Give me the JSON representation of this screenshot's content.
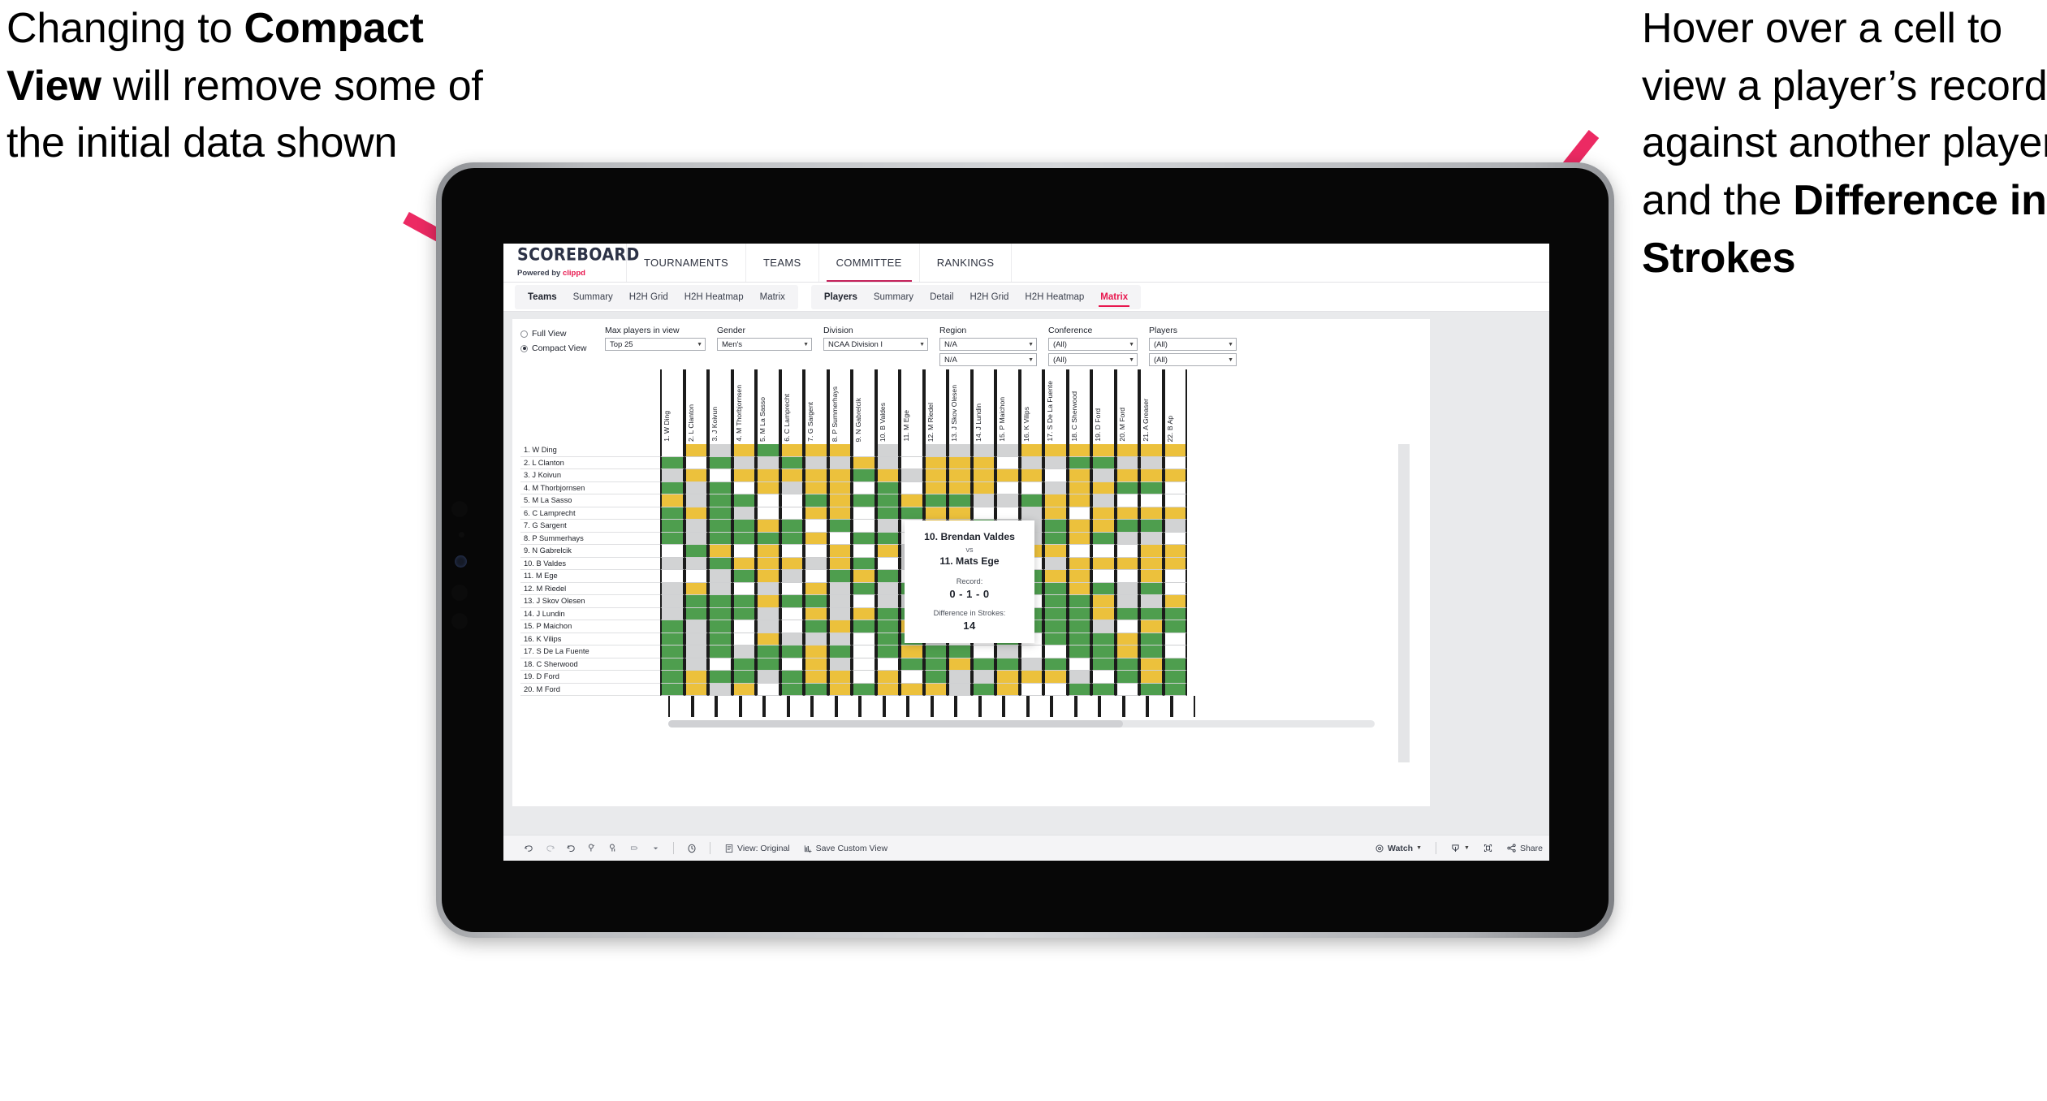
{
  "annotations": {
    "left": {
      "pre": "Changing to ",
      "bold": "Compact View",
      "post": " will remove some of the initial data shown"
    },
    "right": {
      "pre": "Hover over a cell to view a player’s record against another player and the ",
      "bold": "Difference in Strokes"
    },
    "arrow_color": "#ec2a63"
  },
  "app": {
    "brand": {
      "title": "SCOREBOARD",
      "sub_prefix": "Powered by ",
      "sub_brand": "clippd"
    },
    "top_nav": [
      {
        "label": "TOURNAMENTS",
        "active": false
      },
      {
        "label": "TEAMS",
        "active": false
      },
      {
        "label": "COMMITTEE",
        "active": true
      },
      {
        "label": "RANKINGS",
        "active": false
      }
    ],
    "sub_nav": {
      "teams_group": {
        "title": "Teams",
        "items": [
          "Summary",
          "H2H Grid",
          "H2H Heatmap",
          "Matrix"
        ],
        "active": null
      },
      "players_group": {
        "title": "Players",
        "items": [
          "Summary",
          "Detail",
          "H2H Grid",
          "H2H Heatmap",
          "Matrix"
        ],
        "active": "Matrix"
      }
    }
  },
  "filters": {
    "view_mode": {
      "options": [
        "Full View",
        "Compact View"
      ],
      "selected": "Compact View"
    },
    "dropdowns": [
      {
        "label": "Max players in view",
        "value": "Top 25",
        "second": null
      },
      {
        "label": "Gender",
        "value": "Men's",
        "second": null
      },
      {
        "label": "Division",
        "value": "NCAA Division I",
        "second": null
      },
      {
        "label": "Region",
        "value": "N/A",
        "second": "N/A"
      },
      {
        "label": "Conference",
        "value": "(All)",
        "second": "(All)"
      },
      {
        "label": "Players",
        "value": "(All)",
        "second": "(All)"
      }
    ]
  },
  "matrix": {
    "columns": [
      "1. W Ding",
      "2. L Clanton",
      "3. J Koivun",
      "4. M Thorbjornsen",
      "5. M La Sasso",
      "6. C Lamprecht",
      "7. G Sargent",
      "8. P Summerhays",
      "9. N Gabrelcik",
      "10. B Valdes",
      "11. M Ege",
      "12. M Riedel",
      "13. J Skov Olesen",
      "14. J Lundin",
      "15. P Maichon",
      "16. K Vilips",
      "17. S De La Fuente",
      "18. C Sherwood",
      "19. D Ford",
      "20. M Ford",
      "21. A Greaser",
      "22. B Ap"
    ],
    "rows": [
      "1. W Ding",
      "2. L Clanton",
      "3. J Koivun",
      "4. M Thorbjornsen",
      "5. M La Sasso",
      "6. C Lamprecht",
      "7. G Sargent",
      "8. P Summerhays",
      "9. N Gabrelcik",
      "10. B Valdes",
      "11. M Ege",
      "12. M Riedel",
      "13. J Skov Olesen",
      "14. J Lundin",
      "15. P Maichon",
      "16. K Vilips",
      "17. S De La Fuente",
      "18. C Sherwood",
      "19. D Ford",
      "20. M Ford"
    ],
    "legend": {
      "win": "#4e9e4e",
      "tie": "#ecc13c",
      "loss": "#d2d3d4",
      "none": "#ffffff"
    },
    "cells": [
      [
        "w",
        "y",
        "s",
        "y",
        "g",
        "y",
        "y",
        "y",
        "w",
        "s",
        "w",
        "s",
        "s",
        "s",
        "s",
        "y",
        "y",
        "y",
        "y",
        "y",
        "y",
        "y"
      ],
      [
        "g",
        "w",
        "g",
        "s",
        "s",
        "g",
        "s",
        "s",
        "y",
        "s",
        "w",
        "y",
        "y",
        "y",
        "w",
        "s",
        "s",
        "g",
        "g",
        "s",
        "s",
        "w"
      ],
      [
        "s",
        "y",
        "w",
        "y",
        "y",
        "y",
        "y",
        "y",
        "g",
        "y",
        "s",
        "y",
        "y",
        "y",
        "y",
        "y",
        "w",
        "y",
        "s",
        "y",
        "y",
        "y"
      ],
      [
        "g",
        "s",
        "g",
        "w",
        "y",
        "s",
        "y",
        "y",
        "w",
        "g",
        "w",
        "y",
        "y",
        "y",
        "w",
        "w",
        "s",
        "y",
        "y",
        "g",
        "g",
        "w"
      ],
      [
        "y",
        "s",
        "g",
        "g",
        "w",
        "w",
        "g",
        "y",
        "g",
        "g",
        "y",
        "g",
        "g",
        "s",
        "s",
        "g",
        "y",
        "y",
        "s",
        "w",
        "w",
        "w"
      ],
      [
        "g",
        "y",
        "g",
        "s",
        "w",
        "w",
        "y",
        "y",
        "w",
        "g",
        "g",
        "y",
        "y",
        "w",
        "w",
        "s",
        "y",
        "w",
        "y",
        "y",
        "y",
        "y"
      ],
      [
        "g",
        "s",
        "g",
        "g",
        "y",
        "g",
        "w",
        "g",
        "w",
        "s",
        "w",
        "y",
        "y",
        "g",
        "s",
        "s",
        "g",
        "y",
        "y",
        "g",
        "g",
        "s"
      ],
      [
        "g",
        "s",
        "g",
        "g",
        "g",
        "g",
        "y",
        "w",
        "g",
        "g",
        "w",
        "s",
        "y",
        "s",
        "g",
        "s",
        "g",
        "y",
        "g",
        "s",
        "s",
        "w"
      ],
      [
        "w",
        "g",
        "y",
        "w",
        "y",
        "w",
        "w",
        "y",
        "w",
        "y",
        "s",
        "g",
        "s",
        "s",
        "g",
        "y",
        "y",
        "w",
        "w",
        "w",
        "y",
        "y"
      ],
      [
        "s",
        "s",
        "g",
        "y",
        "y",
        "y",
        "s",
        "y",
        "g",
        "w",
        "s",
        "g",
        "s",
        "y",
        "y",
        "w",
        "s",
        "y",
        "y",
        "y",
        "y",
        "y"
      ],
      [
        "w",
        "w",
        "s",
        "g",
        "y",
        "s",
        "w",
        "g",
        "y",
        "g",
        "w",
        "s",
        "s",
        "g",
        "y",
        "g",
        "y",
        "y",
        "w",
        "w",
        "y",
        "w"
      ],
      [
        "s",
        "y",
        "s",
        "w",
        "s",
        "w",
        "y",
        "s",
        "g",
        "s",
        "g",
        "w",
        "g",
        "s",
        "w",
        "g",
        "g",
        "y",
        "g",
        "s",
        "g",
        "w"
      ],
      [
        "s",
        "g",
        "g",
        "g",
        "y",
        "g",
        "g",
        "s",
        "w",
        "s",
        "s",
        "s",
        "w",
        "g",
        "s",
        "w",
        "g",
        "g",
        "y",
        "s",
        "s",
        "y"
      ],
      [
        "s",
        "g",
        "g",
        "g",
        "s",
        "w",
        "y",
        "s",
        "y",
        "g",
        "g",
        "w",
        "s",
        "w",
        "y",
        "g",
        "g",
        "g",
        "y",
        "g",
        "g",
        "g"
      ],
      [
        "g",
        "s",
        "g",
        "w",
        "s",
        "w",
        "g",
        "y",
        "g",
        "g",
        "y",
        "g",
        "w",
        "y",
        "w",
        "g",
        "g",
        "g",
        "s",
        "w",
        "y",
        "g"
      ],
      [
        "g",
        "s",
        "g",
        "w",
        "y",
        "s",
        "s",
        "s",
        "w",
        "g",
        "g",
        "s",
        "w",
        "w",
        "g",
        "w",
        "g",
        "g",
        "g",
        "y",
        "g",
        "w"
      ],
      [
        "g",
        "s",
        "g",
        "s",
        "g",
        "g",
        "y",
        "g",
        "w",
        "g",
        "y",
        "g",
        "g",
        "w",
        "s",
        "w",
        "w",
        "g",
        "g",
        "y",
        "g",
        "w"
      ],
      [
        "g",
        "s",
        "w",
        "g",
        "g",
        "w",
        "y",
        "s",
        "w",
        "w",
        "g",
        "g",
        "y",
        "g",
        "g",
        "s",
        "g",
        "w",
        "g",
        "g",
        "y",
        "g"
      ],
      [
        "g",
        "y",
        "g",
        "g",
        "s",
        "g",
        "y",
        "y",
        "w",
        "y",
        "w",
        "g",
        "s",
        "s",
        "y",
        "y",
        "y",
        "s",
        "w",
        "g",
        "y",
        "g"
      ],
      [
        "g",
        "y",
        "s",
        "y",
        "w",
        "g",
        "g",
        "y",
        "g",
        "y",
        "y",
        "y",
        "s",
        "g",
        "y",
        "w",
        "w",
        "g",
        "g",
        "w",
        "g",
        "g"
      ]
    ]
  },
  "tooltip": {
    "player_a": "10. Brendan Valdes",
    "vs": "vs",
    "player_b": "11. Mats Ege",
    "record_label": "Record:",
    "record_value": "0 - 1 - 0",
    "strokes_label": "Difference in Strokes:",
    "strokes_value": "14"
  },
  "toolbar": {
    "icons": [
      "undo-icon",
      "redo-icon",
      "revert-icon",
      "refresh-icon",
      "pause-icon",
      "highlight-icon",
      "caret-icon",
      "clock-icon"
    ],
    "items": [
      {
        "icon": "view-icon",
        "label": "View: Original"
      },
      {
        "icon": "save-view-icon",
        "label": "Save Custom View"
      },
      {
        "icon": "watch-icon",
        "label": "Watch",
        "caret": true
      },
      {
        "icon": "download-icon",
        "label": "",
        "caret": true
      },
      {
        "icon": "fullscreen-icon",
        "label": ""
      },
      {
        "icon": "share-icon",
        "label": "Share"
      }
    ]
  }
}
